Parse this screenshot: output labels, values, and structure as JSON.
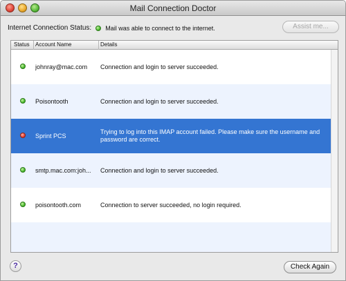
{
  "window": {
    "title": "Mail Connection Doctor"
  },
  "internet_status": {
    "label": "Internet Connection Status:",
    "indicator": "green",
    "message": "Mail was able to connect to the internet."
  },
  "assist_button": {
    "label": "Assist me..."
  },
  "table": {
    "columns": [
      "Status",
      "Account Name",
      "Details"
    ],
    "rows": [
      {
        "status": "green",
        "account": "johnray@mac.com",
        "details": "Connection and login to server succeeded."
      },
      {
        "status": "green",
        "account": "Poisontooth",
        "details": "Connection and login to server succeeded."
      },
      {
        "status": "red",
        "account": "Sprint PCS",
        "details": "Trying to log into this IMAP account failed. Please make sure the username and password are correct."
      },
      {
        "status": "green",
        "account": "smtp.mac.com:joh...",
        "details": "Connection and login to server succeeded."
      },
      {
        "status": "green",
        "account": "poisontooth.com",
        "details": "Connection to server succeeded, no login required."
      }
    ],
    "selected_index": 2
  },
  "help_button": {
    "label": "?"
  },
  "check_again_button": {
    "label": "Check Again"
  },
  "colors": {
    "selection": "#3475d2",
    "alt_row": "#edf3fe",
    "status_ok": "#42b325",
    "status_fail": "#e33b2c"
  }
}
